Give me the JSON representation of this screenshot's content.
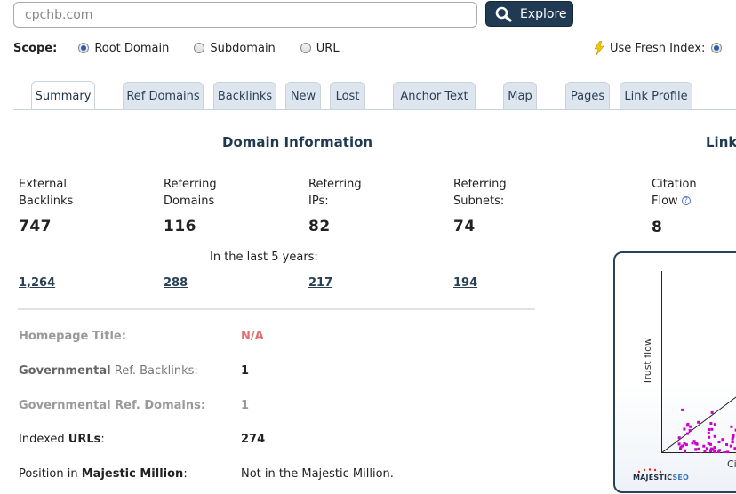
{
  "search": {
    "value": "cpchb.com",
    "button_label": "Explore"
  },
  "scope": {
    "label": "Scope:",
    "options": [
      {
        "label": "Root Domain",
        "selected": true
      },
      {
        "label": "Subdomain",
        "selected": false
      },
      {
        "label": "URL",
        "selected": false
      }
    ],
    "fresh_index_label": "Use Fresh Index:"
  },
  "tabs": [
    "Summary",
    "Ref Domains",
    "Backlinks",
    "New",
    "Lost",
    "Anchor Text",
    "Map",
    "Pages",
    "Link Profile"
  ],
  "domain_info": {
    "title": "Domain Information",
    "metrics": [
      {
        "label_line1": "External",
        "label_line2": "Backlinks",
        "value": "747",
        "historic": "1,264"
      },
      {
        "label_line1": "Referring",
        "label_line2": "Domains",
        "value": "116",
        "historic": "288"
      },
      {
        "label_line1": "Referring",
        "label_line2": "IPs:",
        "value": "82",
        "historic": "217"
      },
      {
        "label_line1": "Referring",
        "label_line2": "Subnets:",
        "value": "74",
        "historic": "194"
      }
    ],
    "last_years_text": "In the last 5 years:"
  },
  "rows": [
    {
      "label": "Homepage Title:",
      "value": "N/A"
    },
    {
      "label_bold": "Governmental",
      "label_rest": " Ref. Backlinks:",
      "value": "1"
    },
    {
      "label": "Governmental Ref. Domains:",
      "value": "1"
    },
    {
      "label_prefix": "Indexed ",
      "label_bold": "URLs",
      "label_suffix": ":",
      "value": "274"
    },
    {
      "label_prefix": "Position in ",
      "label_bold": "Majestic Million",
      "label_suffix": ":",
      "value": "Not in the Majestic Million."
    }
  ],
  "link_profile": {
    "title": "Link",
    "citation_line1": "Citation",
    "citation_line2": "Flow",
    "citation_value": "8",
    "chart_ylabel": "Trust flow",
    "chart_xlabel": "Ci",
    "logo_main": "MAJESTIC",
    "logo_seo": "SEO"
  },
  "colors": {
    "accent": "#1f3a52",
    "tab_bg": "#dde6ee",
    "na_red": "#e07070",
    "scatter": "#cc00cc"
  }
}
